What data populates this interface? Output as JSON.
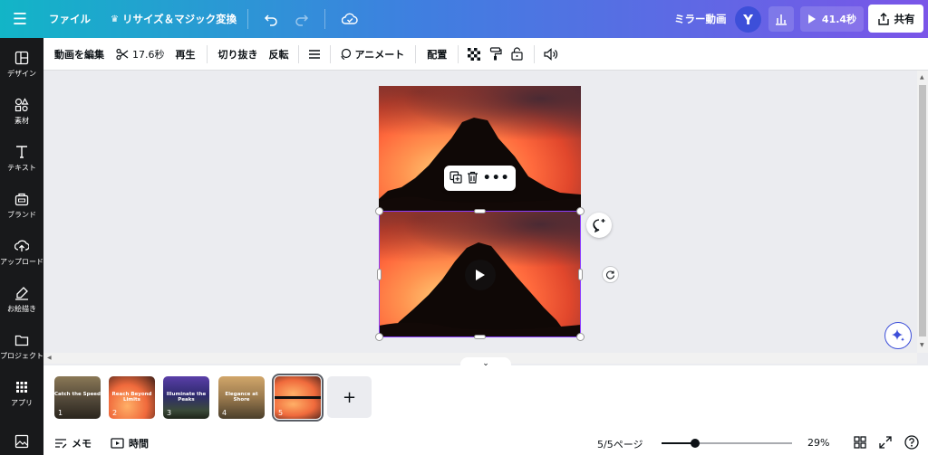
{
  "topbar": {
    "file": "ファイル",
    "resize": "リサイズ＆マジック変換",
    "project_name": "ミラー動画",
    "avatar_letter": "Y",
    "play_duration": "41.4秒",
    "share": "共有"
  },
  "sidebar": {
    "items": [
      {
        "label": "デザイン",
        "icon": "layout-icon"
      },
      {
        "label": "素材",
        "icon": "elements-icon"
      },
      {
        "label": "テキスト",
        "icon": "text-icon"
      },
      {
        "label": "ブランド",
        "icon": "brand-icon"
      },
      {
        "label": "アップロード",
        "icon": "upload-icon"
      },
      {
        "label": "お絵描き",
        "icon": "draw-icon"
      },
      {
        "label": "プロジェクト",
        "icon": "folder-icon"
      },
      {
        "label": "アプリ",
        "icon": "apps-icon"
      }
    ]
  },
  "toolbar": {
    "edit_video": "動画を編集",
    "duration": "17.6秒",
    "playback": "再生",
    "crop": "切り抜き",
    "flip": "反転",
    "animate": "アニメート",
    "position": "配置"
  },
  "timeline": {
    "pages": [
      {
        "caption": "Catch the Speed",
        "num": "1",
        "bg": "#6f6048"
      },
      {
        "caption": "Reach Beyond Limits",
        "num": "2",
        "bg": "#e86a3f"
      },
      {
        "caption": "Illuminate the Peaks",
        "num": "3",
        "bg": "#4a3e86"
      },
      {
        "caption": "Elegance at Shore",
        "num": "4",
        "bg": "#8a7a5a"
      },
      {
        "caption": "",
        "num": "5",
        "bg": "#ef7a4a"
      }
    ],
    "selected_page": 5
  },
  "footer": {
    "notes": "メモ",
    "timer": "時間",
    "page_indicator": "5/5ページ",
    "zoom": "29%",
    "zoom_fraction": 0.26
  },
  "colors": {
    "accent": "#8b3dff",
    "topbar_start": "#12b5c7",
    "topbar_end": "#7a55e8",
    "sidebar_bg": "#18191b"
  }
}
